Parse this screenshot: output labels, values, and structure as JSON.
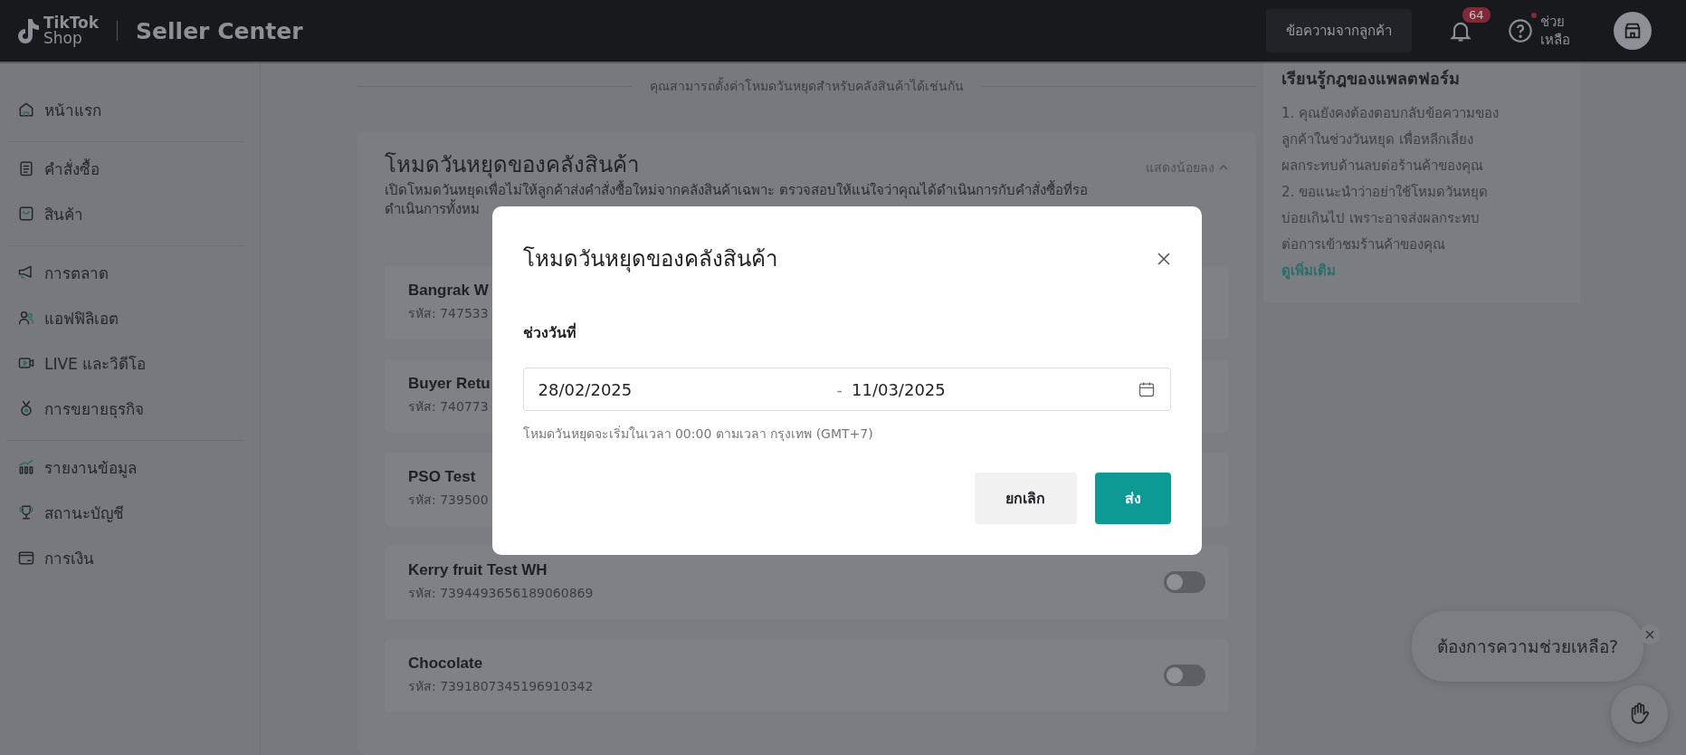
{
  "topbar": {
    "logo_top": "TikTok",
    "logo_bottom": "Shop",
    "product": "Seller Center",
    "messages_button": "ข้อความจากลูกค้า",
    "notification_count": "64",
    "help_lines": [
      "ช่วย",
      "เหลือ"
    ]
  },
  "sidebar": {
    "groups": [
      [
        {
          "label": "หน้าแรก",
          "kind": "home"
        }
      ],
      [
        {
          "label": "คำสั่งซื้อ",
          "kind": "clipboard"
        },
        {
          "label": "สินค้า",
          "kind": "bag"
        }
      ],
      [
        {
          "label": "การตลาด",
          "kind": "megaphone"
        },
        {
          "label": "แอฟฟิลิเอต",
          "kind": "people"
        },
        {
          "label": "LIVE และวิดีโอ",
          "kind": "video"
        },
        {
          "label": "การขยายธุรกิจ",
          "kind": "medal"
        }
      ],
      [
        {
          "label": "รายงานข้อมูล",
          "kind": "chart"
        },
        {
          "label": "สถานะบัญชี",
          "kind": "trophy"
        },
        {
          "label": "การเงิน",
          "kind": "wallet"
        }
      ]
    ]
  },
  "notice": "คุณสามารถตั้งค่าโหมดวันหยุดสำหรับคลังสินค้าได้เช่นกัน",
  "warehouse_card": {
    "title": "โหมดวันหยุดของคลังสินค้า",
    "collapse_link": "แสดงน้อยลง",
    "description_lines": [
      "เปิดโหมดวันหยุดเพื่อไม่ให้ลูกค้าส่งคำสั่งซื้อใหม่จากคลังสินค้าเฉพาะ ตรวจสอบให้แน่ใจว่าคุณได้ดำเนินการกับคำสั่งซื้อที่รอ",
      "ดำเนินการทั้งหม"
    ],
    "rows": [
      {
        "name": "Bangrak W",
        "code": "รหัส: 747533"
      },
      {
        "name": "Buyer Retu",
        "code": "รหัส: 740773"
      },
      {
        "name": "PSO Test",
        "code": "รหัส: 739500"
      },
      {
        "name": "Kerry fruit Test WH",
        "code": "รหัส: 7394493656189060869",
        "on": false
      },
      {
        "name": "Chocolate",
        "code": "รหัส: 7391807345196910342",
        "on": false
      }
    ]
  },
  "rules_panel": {
    "title": "เรียนรู้กฎของแพลตฟอร์ม",
    "lines": [
      "1. คุณยังคงต้องตอบกลับข้อความของ",
      "ลูกค้าในช่วงวันหยุด เพื่อหลีกเลี่ยง",
      "ผลกระทบด้านลบต่อร้านค้าของคุณ",
      "2. ขอแนะนำว่าอย่าใช้โหมดวันหยุด",
      "บ่อยเกินไป เพราะอาจส่งผลกระทบ",
      "ต่อการเข้าชมร้านค้าของคุณ"
    ],
    "link": "ดูเพิ่มเติม"
  },
  "modal": {
    "title": "โหมดวันหยุดของคลังสินค้า",
    "date_label": "ช่วงวันที่",
    "start_date": "28/02/2025",
    "separator": "-",
    "end_date": "11/03/2025",
    "hint": "โหมดวันหยุดจะเริ่มในเวลา 00:00 ตามเวลา กรุงเทพ (GMT+7)",
    "cancel": "ยกเลิก",
    "submit": "ส่ง"
  },
  "help_bubble": {
    "text": "ต้องการความช่วยเหลือ?"
  }
}
